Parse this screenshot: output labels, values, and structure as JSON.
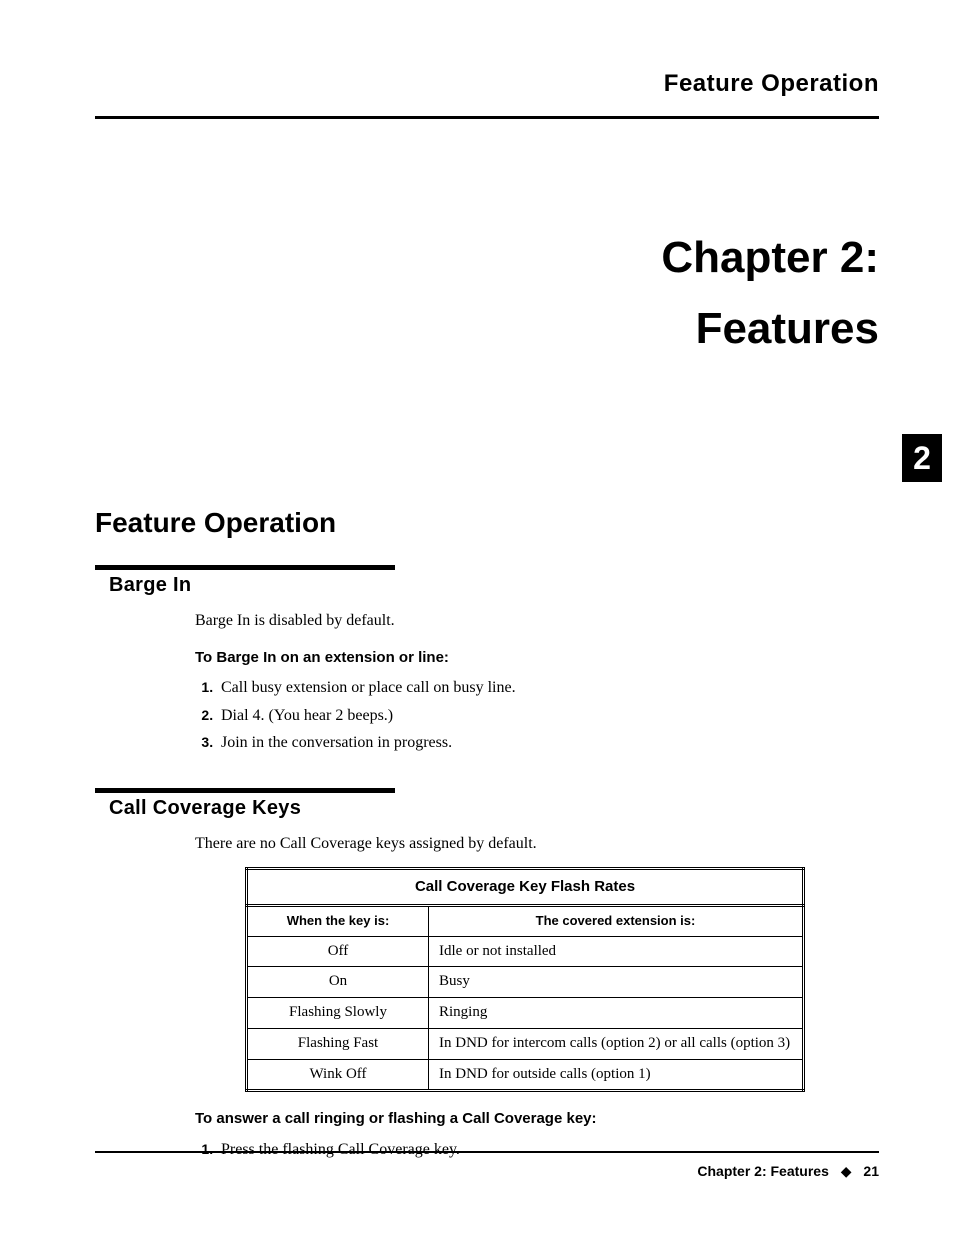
{
  "header": {
    "running_head": "Feature Operation"
  },
  "title": {
    "line1": "Chapter 2:",
    "line2": "Features"
  },
  "tab_number": "2",
  "section": {
    "heading": "Feature Operation"
  },
  "barge_in": {
    "heading": "Barge In",
    "intro": "Barge In is disabled by default.",
    "instr_head": "To Barge In on an extension or line:",
    "steps": [
      "Call busy extension or place call on busy line.",
      "Dial 4. (You hear 2 beeps.)",
      "Join in the conversation in progress."
    ]
  },
  "call_coverage": {
    "heading": "Call Coverage Keys",
    "intro": "There are no Call Coverage keys assigned by default.",
    "table": {
      "title": "Call Coverage Key Flash Rates",
      "col1": "When the key is:",
      "col2": "The covered extension is:",
      "rows": [
        {
          "key": "Off",
          "ext": "Idle or not installed"
        },
        {
          "key": "On",
          "ext": "Busy"
        },
        {
          "key": "Flashing Slowly",
          "ext": "Ringing"
        },
        {
          "key": "Flashing Fast",
          "ext": "In DND for intercom calls (option 2) or all calls (option 3)"
        },
        {
          "key": "Wink Off",
          "ext": "In DND for outside calls (option 1)"
        }
      ]
    },
    "instr_head": "To answer a call ringing or flashing a Call Coverage key:",
    "steps": [
      "Press the flashing Call Coverage key."
    ]
  },
  "footer": {
    "chapter": "Chapter 2: Features",
    "page": "21"
  }
}
